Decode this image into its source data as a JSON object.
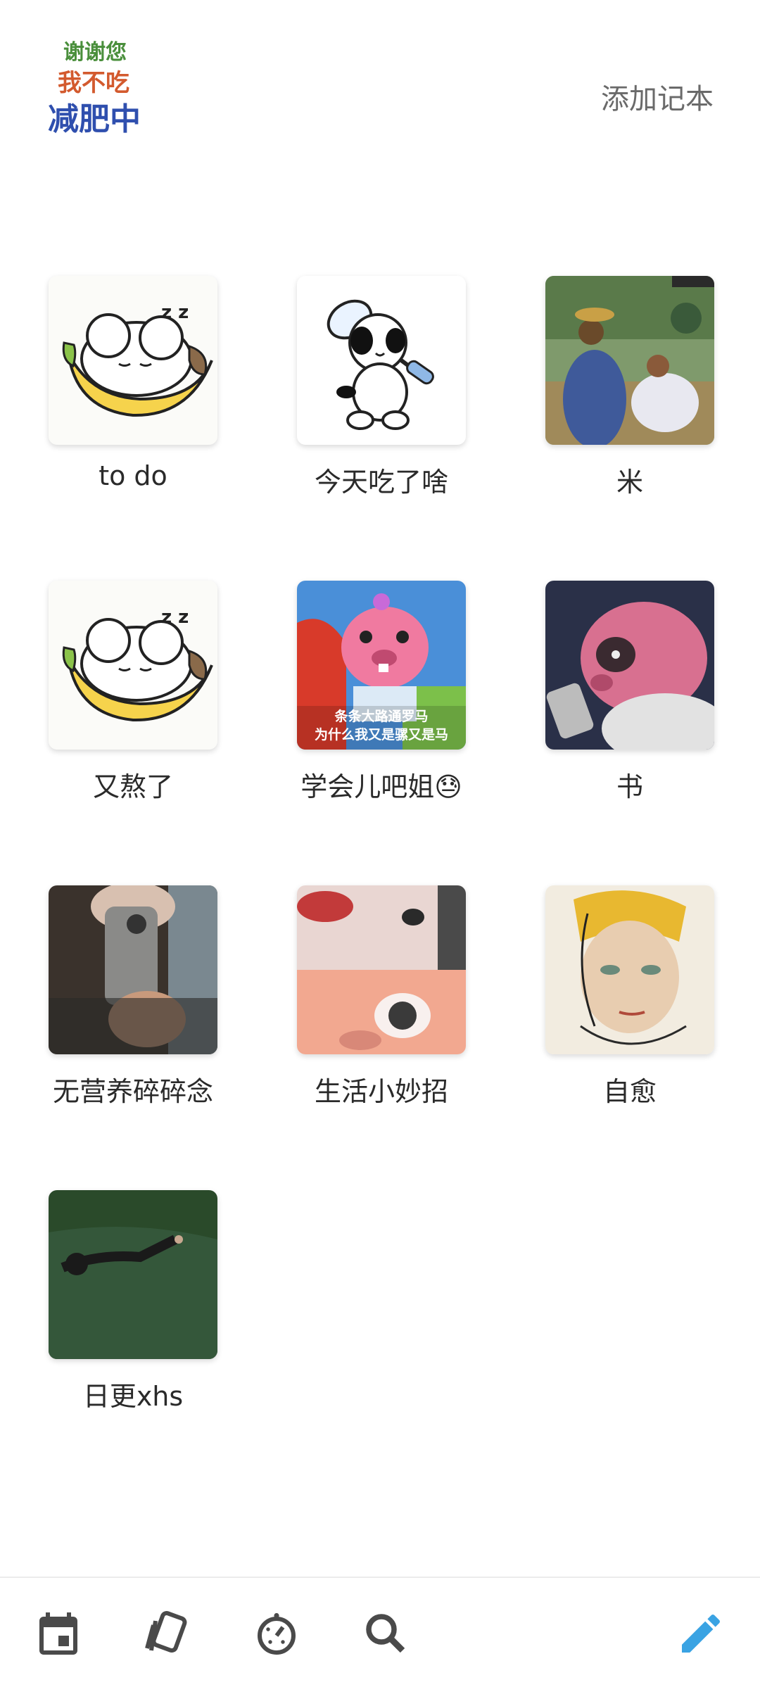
{
  "header": {
    "logo_line1": "谢谢您",
    "logo_line2": "我不吃",
    "logo_line3": "减肥中",
    "add_notebook": "添加记本"
  },
  "notebooks": [
    {
      "title": "to do",
      "thumb": "sleeping-dog-banana"
    },
    {
      "title": "今天吃了啥",
      "thumb": "cartoon-dog-racket"
    },
    {
      "title": "米",
      "thumb": "painting-figures"
    },
    {
      "title": "又熬了",
      "thumb": "sleeping-dog-banana"
    },
    {
      "title": "学会儿吧姐😓",
      "thumb": "pink-beaver",
      "thumb_caption1": "条条大路通罗马",
      "thumb_caption2": "为什么我又是骡又是马"
    },
    {
      "title": "书",
      "thumb": "pink-animal-phone"
    },
    {
      "title": "无营养碎碎念",
      "thumb": "mirror-selfie"
    },
    {
      "title": "生活小妙招",
      "thumb": "face-collage"
    },
    {
      "title": "自愈",
      "thumb": "face-painting"
    },
    {
      "title": "日更xhs",
      "thumb": "person-in-grass"
    }
  ],
  "bottom_nav": [
    {
      "icon": "calendar-icon"
    },
    {
      "icon": "cards-icon"
    },
    {
      "icon": "timer-icon"
    },
    {
      "icon": "search-icon"
    },
    {
      "icon": "edit-pencil-icon"
    }
  ],
  "colors": {
    "accent": "#3aa3e3",
    "nav_icon": "#4a4a4a"
  }
}
